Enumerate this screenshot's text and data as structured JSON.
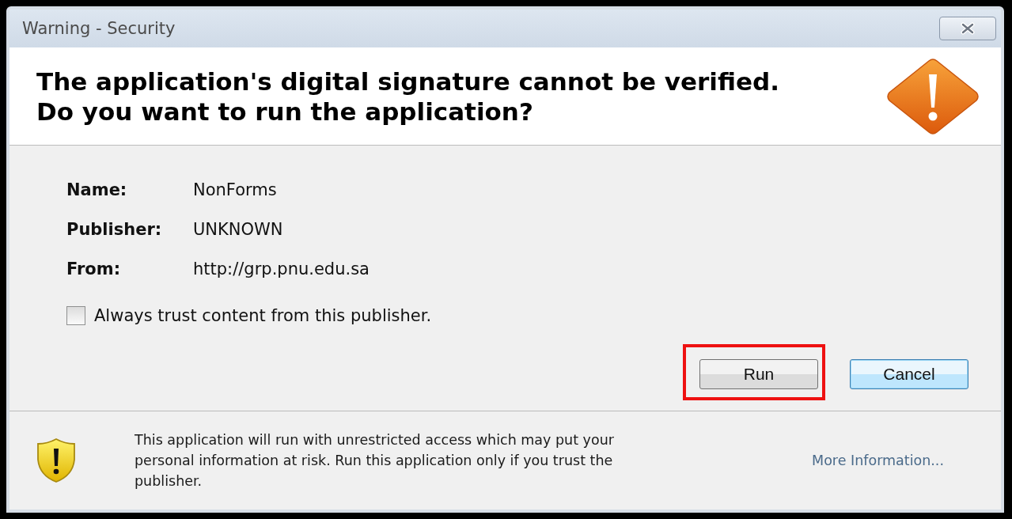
{
  "window": {
    "title": "Warning - Security"
  },
  "headline": [
    "The application's digital signature cannot be verified.",
    "Do you want to run the application?"
  ],
  "details": [
    {
      "label": "Name:",
      "value": "NonForms"
    },
    {
      "label": "Publisher:",
      "value": "UNKNOWN"
    },
    {
      "label": "From:",
      "value": "http://grp.pnu.edu.sa"
    }
  ],
  "trust_checkbox": {
    "label": "Always trust content from this publisher.",
    "checked": false
  },
  "buttons": [
    {
      "label": "Run",
      "highlighted": true,
      "default": false
    },
    {
      "label": "Cancel",
      "highlighted": false,
      "default": true
    }
  ],
  "footer": {
    "message": "This application will run with unrestricted access which may put your personal information at risk. Run this application only if you trust the publisher.",
    "link": "More Information..."
  }
}
